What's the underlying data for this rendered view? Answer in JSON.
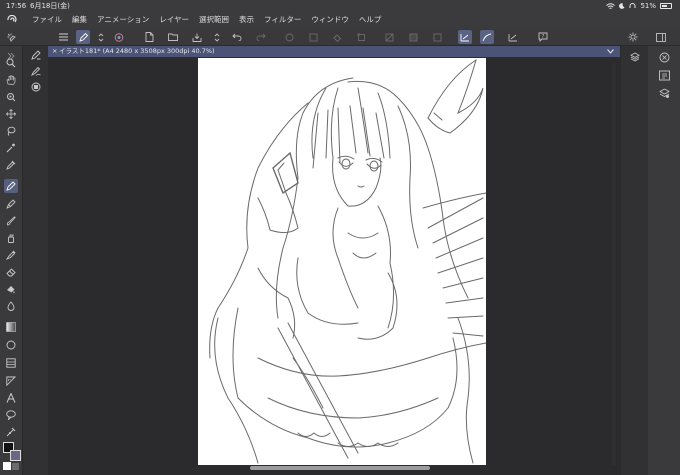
{
  "status_bar": {
    "time": "17:56",
    "date": "6月18日(金)",
    "battery_text": "51%",
    "battery_level": 0.51
  },
  "menu": {
    "items": [
      "ファイル",
      "編集",
      "アニメーション",
      "レイヤー",
      "選択範囲",
      "表示",
      "フィルター",
      "ウィンドウ",
      "ヘルプ"
    ]
  },
  "document": {
    "tab_title": "イラスト181* (A4 2480 x 3508px 300dpi 40.7%)",
    "close_glyph": "×"
  },
  "colors": {
    "accent": "#5a6384",
    "main_color": "#111111",
    "sub_color": "#6c6584",
    "canvas_bg": "#2b2b2d",
    "paper": "#ffffff"
  },
  "tools": {
    "left": [
      "zoom-icon",
      "hand-icon",
      "rotate-icon",
      "move-icon",
      "lasso-icon",
      "magic-wand-icon",
      "eyedropper-icon",
      "pen-icon",
      "pencil-icon",
      "brush-icon",
      "airbrush-icon",
      "decoration-icon",
      "eraser-icon",
      "blend-icon",
      "fill-icon",
      "gradient-icon",
      "figure-icon",
      "frame-icon",
      "ruler-icon",
      "text-icon",
      "balloon-icon",
      "correct-line-icon"
    ]
  }
}
